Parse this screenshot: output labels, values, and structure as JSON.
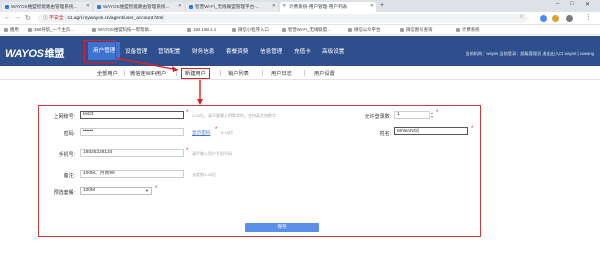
{
  "browser": {
    "tabs": [
      {
        "title": "WAYOS维盟智能路由管理系统..."
      },
      {
        "title": "WAYOS维盟智能路由管理系统..."
      },
      {
        "title": "智营Wi-Fi_无线联盟管理平台-..."
      },
      {
        "title": "计费系统-用户管理-用户列表"
      }
    ],
    "new_tab": "+",
    "window_controls": [
      "–",
      "□",
      "✕"
    ],
    "security_label": "不安全",
    "url": "s1.agrl.mywayos.cn/agent/user_account.html",
    "bookmarks": [
      "應用",
      "360导航_一个主页...",
      "WAYOS维盟科技一帮帮助...",
      "192.168.1.1",
      "微信小程序入口",
      "智营Wi-Fi_无线联盟...",
      "微信公众平台",
      "微信图号查询",
      "计费系统"
    ]
  },
  "header": {
    "logo": "WAYOS",
    "logo_cn": "维盟",
    "menu": [
      "用户管理",
      "设备管理",
      "营销配置",
      "财务信息",
      "套餐资费",
      "信息管理",
      "充值卡",
      "高级设置"
    ],
    "user_info": "当前机构：wayos  当前登录：超级管理员  退出出入口  wayos | xxwang"
  },
  "subnav": {
    "items": [
      "全部用户",
      "微信连WiFi用户",
      "新建用户",
      "销户列表",
      "用户日志",
      "用户设置"
    ],
    "active_index": 2
  },
  "form": {
    "account": {
      "label": "上网账号:",
      "value": "test3",
      "hint": "4-20位，请不要输入特殊字符，支持英文和数字"
    },
    "max_login": {
      "label": "允许登录数:",
      "value": "1"
    },
    "password": {
      "label": "密码:",
      "value": "••••••",
      "link": "显示密码",
      "hint": "6-18位"
    },
    "name": {
      "label": "姓名:",
      "value": "MrWANG"
    },
    "phone": {
      "label": "手机号:",
      "value": "18826228134",
      "hint": "请手输入用户手机号码"
    },
    "remark": {
      "label": "备注:",
      "value": "100M、月费99",
      "hint": "长度限1-20位"
    },
    "package": {
      "label": "预选套餐:",
      "value": "100M"
    },
    "save_label": "保存"
  },
  "colors": {
    "header_bg": "#2e4f8c",
    "menu_active": "#3f73d1",
    "highlight_red": "#e02020",
    "save_button": "#5b8ee6"
  }
}
